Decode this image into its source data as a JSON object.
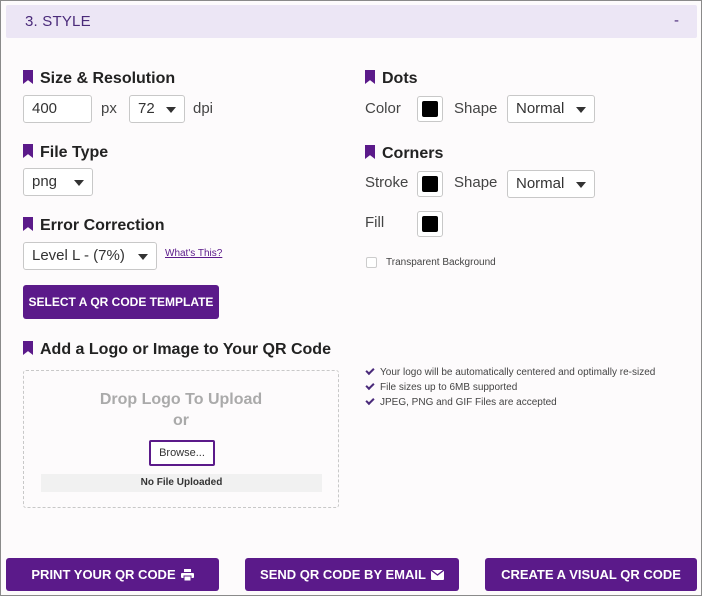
{
  "section": {
    "title": "3. STYLE",
    "collapse_label": "-"
  },
  "size_resolution": {
    "heading": "Size & Resolution",
    "size_value": "400",
    "size_unit": "px",
    "dpi_value": "72",
    "dpi_unit": "dpi"
  },
  "file_type": {
    "heading": "File Type",
    "value": "png"
  },
  "error_correction": {
    "heading": "Error Correction",
    "value": "Level L - (7%)",
    "help_link": "What's This?"
  },
  "template_button": "SELECT A QR CODE TEMPLATE",
  "dots": {
    "heading": "Dots",
    "color_label": "Color",
    "shape_label": "Shape",
    "shape_value": "Normal",
    "color": "#000000"
  },
  "corners": {
    "heading": "Corners",
    "stroke_label": "Stroke",
    "shape_label": "Shape",
    "shape_value": "Normal",
    "fill_label": "Fill",
    "stroke_color": "#000000",
    "fill_color": "#000000"
  },
  "transparent_background_label": "Transparent Background",
  "logo": {
    "heading": "Add a Logo or Image to Your QR Code",
    "drop_title": "Drop Logo To Upload",
    "drop_or": "or",
    "browse_label": "Browse...",
    "file_status": "No File Uploaded",
    "notes": [
      "Your logo will be automatically centered and optimally re-sized",
      "File sizes up to 6MB supported",
      "JPEG, PNG and GIF Files are accepted"
    ]
  },
  "footer": {
    "print_label": "PRINT YOUR QR CODE",
    "email_label": "SEND QR CODE BY EMAIL",
    "visual_label": "CREATE A VISUAL QR CODE"
  },
  "colors": {
    "accent": "#5b1a8a",
    "header_bg": "#ece6f5"
  }
}
